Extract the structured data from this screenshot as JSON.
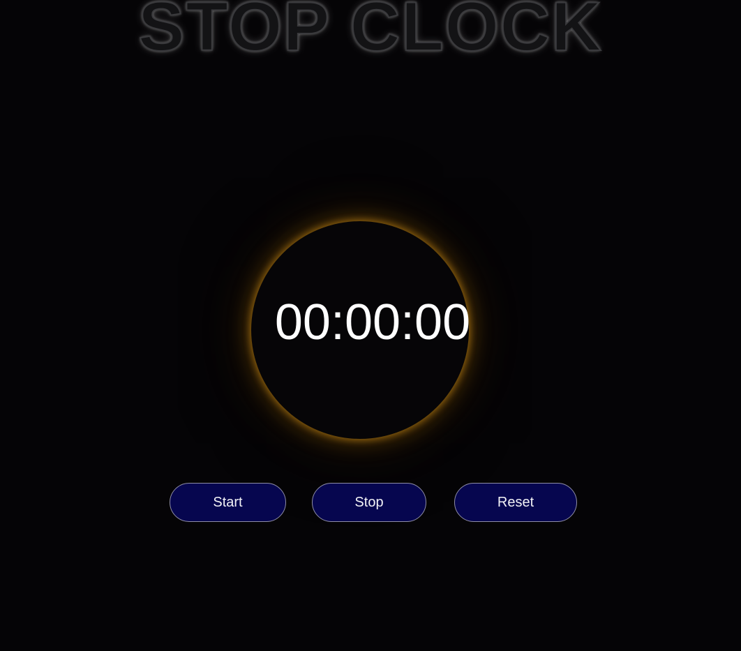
{
  "header": {
    "title": "STOP CLOCK"
  },
  "clock": {
    "display": "00:00:00"
  },
  "controls": {
    "start_label": "Start",
    "stop_label": "Stop",
    "reset_label": "Reset"
  },
  "colors": {
    "background": "#050406",
    "dial_glow": "#be8214",
    "button_fill": "#06064f",
    "button_border": "#8f8ea6",
    "text": "#ffffff"
  }
}
